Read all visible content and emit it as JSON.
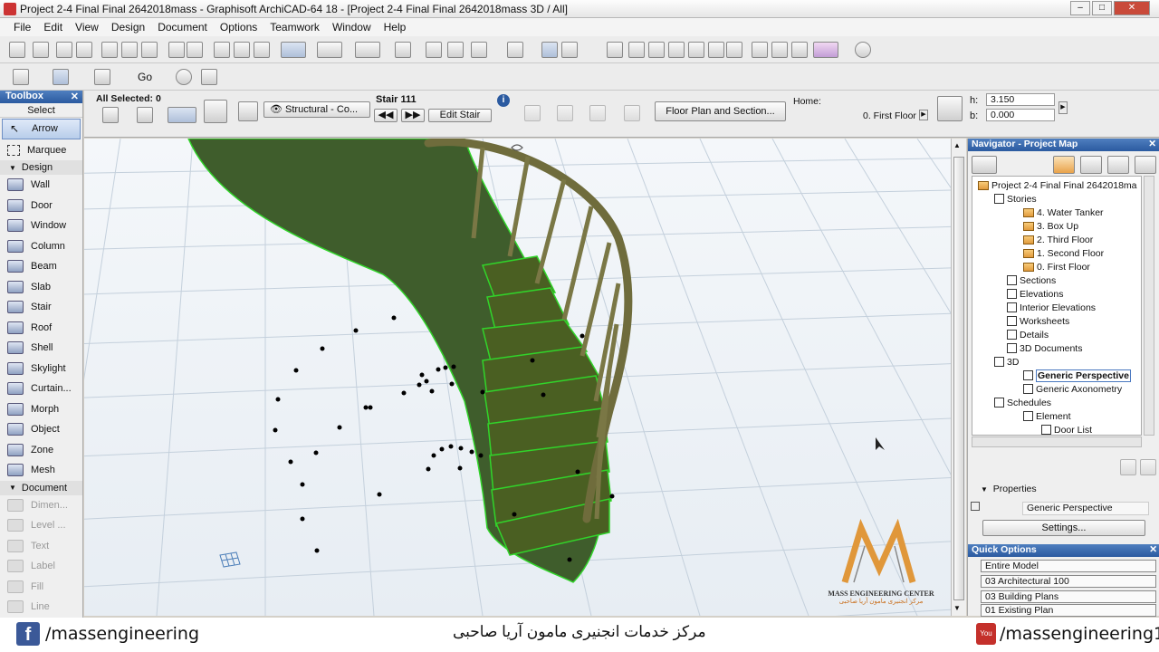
{
  "window": {
    "title": "Project 2-4 Final Final 2642018mass - Graphisoft ArchiCAD-64 18 - [Project 2-4 Final Final 2642018mass 3D / All]"
  },
  "menu": [
    "File",
    "Edit",
    "View",
    "Design",
    "Document",
    "Options",
    "Teamwork",
    "Window",
    "Help"
  ],
  "toolbar2": {
    "go_label": "Go"
  },
  "toolbox": {
    "title": "Toolbox",
    "select": "Select",
    "pointer": [
      "Arrow",
      "Marquee"
    ],
    "design_label": "Design",
    "design": [
      "Wall",
      "Door",
      "Window",
      "Column",
      "Beam",
      "Slab",
      "Stair",
      "Roof",
      "Shell",
      "Skylight",
      "Curtain...",
      "Morph",
      "Object",
      "Zone",
      "Mesh"
    ],
    "document_label": "Document",
    "document": [
      "Dimen...",
      "Level ...",
      "Text",
      "Label",
      "Fill",
      "Line"
    ]
  },
  "infobox": {
    "selected": "All Selected: 0",
    "layer": "Structural - Co...",
    "stair_name": "Stair 111",
    "edit_stair": "Edit Stair",
    "floor_plan_section": "Floor Plan and Section...",
    "home_label": "Home:",
    "home_story": "0. First Floor",
    "h_label": "h:",
    "h_value": "3.150",
    "b_label": "b:",
    "b_value": "0.000"
  },
  "navigator": {
    "title": "Navigator - Project Map",
    "project": "Project 2-4 Final Final 2642018ma",
    "stories_label": "Stories",
    "stories": [
      "4. Water Tanker",
      "3. Box Up",
      "2. Third Floor",
      "1. Second Floor",
      "0. First Floor"
    ],
    "views": [
      "Sections",
      "Elevations",
      "Interior Elevations",
      "Worksheets",
      "Details",
      "3D Documents"
    ],
    "threed": "3D",
    "threed_items": [
      "Generic Perspective",
      "Generic Axonometry"
    ],
    "schedules": "Schedules",
    "element": "Element",
    "door_list": "Door List",
    "properties_label": "Properties",
    "properties_value": "Generic Perspective",
    "settings": "Settings..."
  },
  "quick_options": {
    "title": "Quick Options",
    "items": [
      "Entire Model",
      "03 Architectural 100",
      "03 Building Plans",
      "01 Existing Plan"
    ]
  },
  "watermark": {
    "name": "MASS ENGINEERING CENTER",
    "arabic": "مركز انجنيرى مامون آريا صاحبى"
  },
  "footer": {
    "facebook": "/massengineering",
    "center": "مرکز خدمات انجنیری مامون آریا صاحبی",
    "youtube": "/massengineering1"
  },
  "colors": {
    "accent": "#2b5aa0",
    "stair": "#3f5d2c",
    "edge": "#31d42a",
    "rail": "#6f6c3c"
  }
}
